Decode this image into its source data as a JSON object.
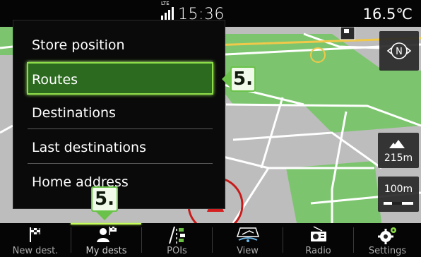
{
  "status": {
    "clock": "15:36",
    "network": "LTE",
    "temperature": "16.5℃"
  },
  "menu": {
    "items": [
      {
        "label": "Store position"
      },
      {
        "label": "Routes",
        "selected": true
      },
      {
        "label": "Destinations"
      },
      {
        "label": "Last destinations"
      },
      {
        "label": "Home address"
      }
    ]
  },
  "callouts": {
    "routes": "5.",
    "my_dests": "5."
  },
  "map_controls": {
    "compass": "N",
    "altitude": "215m",
    "scale": "100m"
  },
  "bottom_bar": {
    "tabs": [
      {
        "label": "New dest.",
        "icon": "flag-icon"
      },
      {
        "label": "My dests",
        "icon": "person-flag-icon",
        "active": true
      },
      {
        "label": "POIs",
        "icon": "poi-road-icon"
      },
      {
        "label": "View",
        "icon": "map-view-icon"
      },
      {
        "label": "Radio",
        "icon": "radio-icon"
      },
      {
        "label": "Settings",
        "icon": "gears-icon"
      }
    ]
  },
  "colors": {
    "accent_green": "#8edc49",
    "selected_bg": "#2c6b1f",
    "callout_green": "#6bc24a",
    "map_bg": "#bfbfbf",
    "park_green": "#7cc56e"
  }
}
